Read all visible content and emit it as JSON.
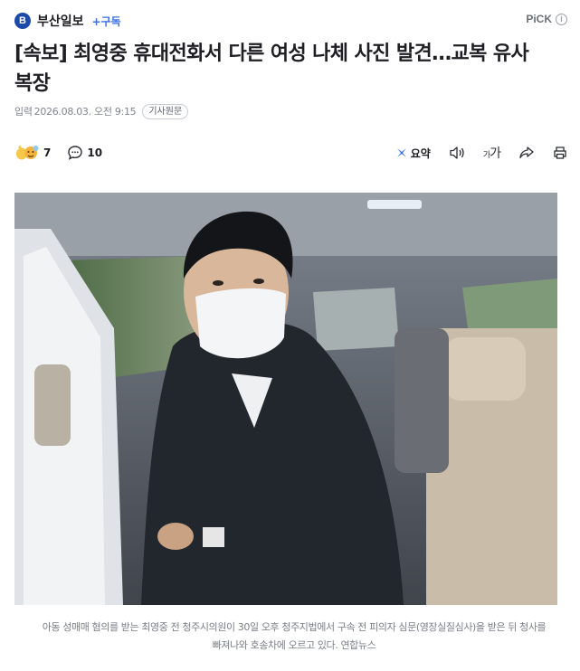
{
  "press": {
    "logo_letter": "B",
    "name": "부산일보",
    "subscribe": "+구독",
    "pick": "PiCK",
    "pick_info": "i"
  },
  "article": {
    "title": "[속보] 최영중 휴대전화서 다른 여성 나체 사진 발견…교복 유사 복장",
    "date_label": "입력",
    "date": "2026.08.03. 오전 9:15",
    "original_button": "기사원문"
  },
  "actions": {
    "reaction_count": "7",
    "comment_count": "10",
    "summary": "요약",
    "font_size_label": "가"
  },
  "photo": {
    "caption": "아동 성매매 혐의를 받는 최영중 전 청주시의원이 30일 오후 청주지법에서 구속 전 피의자 심문(영장실질심사)을 받은 뒤 청사를 빠져나와 호송차에 오르고 있다. 연합뉴스"
  },
  "colors": {
    "brand": "#1d4aa8",
    "subscribe": "#3a6ee8",
    "summary_icon": "#2f6bf2"
  },
  "icons": [
    "reaction-emoji-icon",
    "comment-icon",
    "summary-icon",
    "audio-icon",
    "font-size-icon",
    "share-icon",
    "print-icon",
    "info-icon"
  ]
}
